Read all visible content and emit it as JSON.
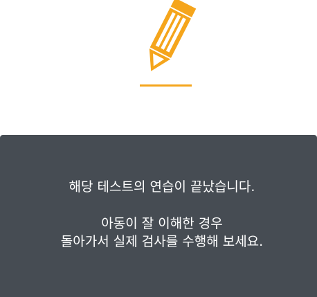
{
  "icon": {
    "name": "pencil-icon",
    "color": "#f5a51c"
  },
  "panel": {
    "background": "#464c53",
    "text_color": "#ffffff",
    "messages": {
      "line1": "해당 테스트의 연습이 끝났습니다.",
      "line2": "아동이 잘 이해한 경우",
      "line3": "돌아가서 실제 검사를 수행해 보세요."
    }
  }
}
